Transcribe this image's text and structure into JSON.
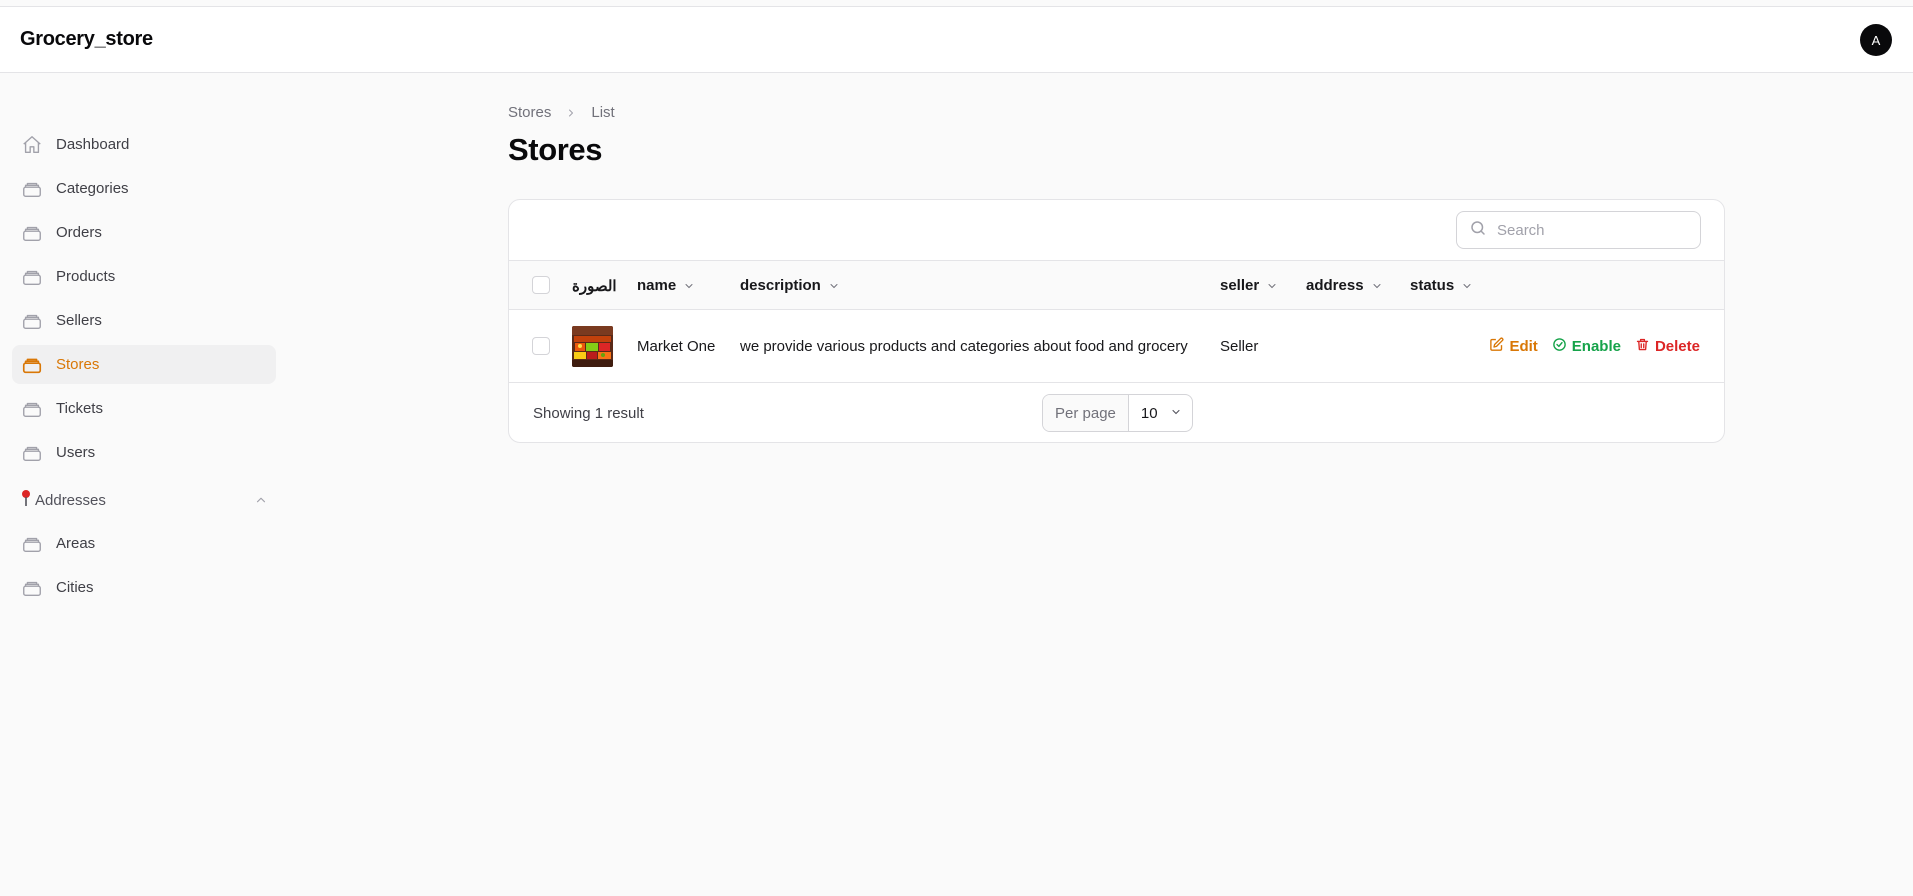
{
  "app": {
    "brand": "Grocery_store",
    "avatar_initial": "A"
  },
  "sidebar": {
    "items": [
      {
        "label": "Dashboard",
        "icon": "home-icon"
      },
      {
        "label": "Categories",
        "icon": "stack-icon"
      },
      {
        "label": "Orders",
        "icon": "stack-icon"
      },
      {
        "label": "Products",
        "icon": "stack-icon"
      },
      {
        "label": "Sellers",
        "icon": "stack-icon"
      },
      {
        "label": "Stores",
        "icon": "stack-icon",
        "active": true
      },
      {
        "label": "Tickets",
        "icon": "stack-icon"
      },
      {
        "label": "Users",
        "icon": "stack-icon"
      }
    ],
    "group": {
      "label": "Addresses",
      "icon": "pushpin-icon",
      "items": [
        {
          "label": "Areas",
          "icon": "stack-icon"
        },
        {
          "label": "Cities",
          "icon": "stack-icon"
        }
      ]
    }
  },
  "breadcrumb": {
    "parent": "Stores",
    "current": "List"
  },
  "page": {
    "title": "Stores"
  },
  "search": {
    "placeholder": "Search"
  },
  "table": {
    "columns": {
      "image": "الصورة",
      "name": "name",
      "description": "description",
      "seller": "seller",
      "address": "address",
      "status": "status"
    },
    "rows": [
      {
        "name": "Market One",
        "description": "we provide various products and categories about food and grocery",
        "seller": "Seller",
        "address": "",
        "status": ""
      }
    ],
    "actions": {
      "edit": "Edit",
      "enable": "Enable",
      "delete": "Delete"
    }
  },
  "pagination": {
    "showing": "Showing 1 result",
    "per_page_label": "Per page",
    "per_page_value": "10"
  },
  "colors": {
    "accent": "#d97706",
    "success": "#16a34a",
    "danger": "#dc2626"
  }
}
